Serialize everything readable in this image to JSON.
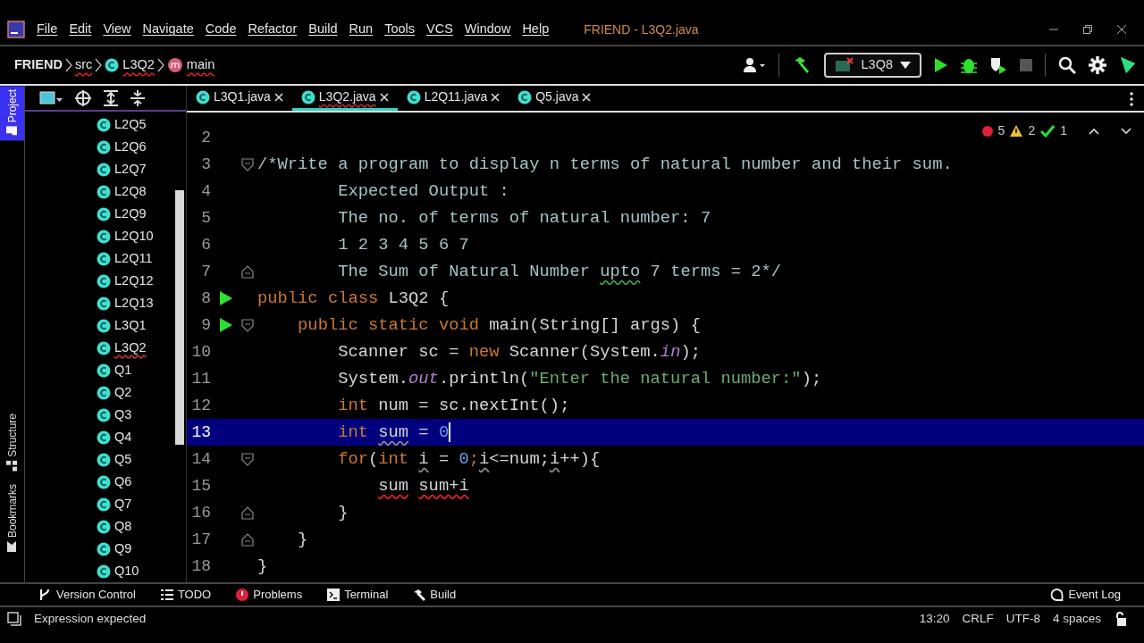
{
  "window": {
    "title": "FRIEND - L3Q2.java"
  },
  "menu": [
    "File",
    "Edit",
    "View",
    "Navigate",
    "Code",
    "Refactor",
    "Build",
    "Run",
    "Tools",
    "VCS",
    "Window",
    "Help"
  ],
  "breadcrumbs": [
    {
      "label": "FRIEND",
      "kind": "project"
    },
    {
      "label": "src",
      "kind": "folder"
    },
    {
      "label": "L3Q2",
      "kind": "class"
    },
    {
      "label": "main",
      "kind": "method"
    }
  ],
  "run_config": {
    "label": "L3Q8"
  },
  "side_tabs": [
    {
      "label": "Project",
      "selected": true
    },
    {
      "label": "Structure",
      "selected": false
    },
    {
      "label": "Bookmarks",
      "selected": false
    }
  ],
  "project_tree": [
    {
      "label": "L2Q5",
      "error": false
    },
    {
      "label": "L2Q6",
      "error": false
    },
    {
      "label": "L2Q7",
      "error": false
    },
    {
      "label": "L2Q8",
      "error": false
    },
    {
      "label": "L2Q9",
      "error": false
    },
    {
      "label": "L2Q10",
      "error": false
    },
    {
      "label": "L2Q11",
      "error": false
    },
    {
      "label": "L2Q12",
      "error": false
    },
    {
      "label": "L2Q13",
      "error": false
    },
    {
      "label": "L3Q1",
      "error": false
    },
    {
      "label": "L3Q2",
      "error": true
    },
    {
      "label": "Q1",
      "error": false
    },
    {
      "label": "Q2",
      "error": false
    },
    {
      "label": "Q3",
      "error": false
    },
    {
      "label": "Q4",
      "error": false
    },
    {
      "label": "Q5",
      "error": false
    },
    {
      "label": "Q6",
      "error": false
    },
    {
      "label": "Q7",
      "error": false
    },
    {
      "label": "Q8",
      "error": false
    },
    {
      "label": "Q9",
      "error": false
    },
    {
      "label": "Q10",
      "error": false
    }
  ],
  "tabs": [
    {
      "label": "L3Q1.java",
      "selected": false,
      "error": false
    },
    {
      "label": "L3Q2.java",
      "selected": true,
      "error": true
    },
    {
      "label": "L2Q11.java",
      "selected": false,
      "error": false
    },
    {
      "label": "Q5.java",
      "selected": false,
      "error": false
    }
  ],
  "inspections": {
    "errors": "5",
    "warnings": "2",
    "weak": "1"
  },
  "code_lines": [
    {
      "number": "2"
    },
    {
      "number": "3",
      "fold_start": true,
      "tokens": [
        {
          "text": "/*Write a program to display n terms of natural number and their sum.",
          "kind": "comment"
        }
      ]
    },
    {
      "number": "4",
      "tokens": [
        {
          "text": "        Expected Output :",
          "kind": "comment"
        }
      ]
    },
    {
      "number": "5",
      "tokens": [
        {
          "text": "        The no. of terms of natural number: 7",
          "kind": "comment"
        }
      ]
    },
    {
      "number": "6",
      "tokens": [
        {
          "text": "        1 2 3 4 5 6 7",
          "kind": "comment"
        }
      ]
    },
    {
      "number": "7",
      "fold_end": true,
      "tokens": [
        {
          "text": "        The Sum of Natural Number ",
          "kind": "comment"
        },
        {
          "text": "upto",
          "kind": "typo"
        },
        {
          "text": " 7 terms = 2*/",
          "kind": "comment"
        }
      ]
    },
    {
      "number": "8",
      "run": true,
      "tokens": [
        {
          "text": "public class ",
          "kind": "keyword"
        },
        {
          "text": "L3Q2 {",
          "kind": "plain"
        }
      ]
    },
    {
      "number": "9",
      "run": true,
      "fold_start": true,
      "tokens": [
        {
          "text": "    public static void ",
          "kind": "keyword"
        },
        {
          "text": "main(String[] args) {",
          "kind": "plain"
        }
      ]
    },
    {
      "number": "10",
      "tokens": [
        {
          "text": "        Scanner sc = ",
          "kind": "plain"
        },
        {
          "text": "new ",
          "kind": "keyword"
        },
        {
          "text": "Scanner(System.",
          "kind": "plain"
        },
        {
          "text": "in",
          "kind": "field"
        },
        {
          "text": ");",
          "kind": "plain"
        }
      ]
    },
    {
      "number": "11",
      "tokens": [
        {
          "text": "        System.",
          "kind": "plain"
        },
        {
          "text": "out",
          "kind": "field"
        },
        {
          "text": ".println(",
          "kind": "plain"
        },
        {
          "text": "\"Enter the natural number:\"",
          "kind": "string"
        },
        {
          "text": ");",
          "kind": "plain"
        }
      ]
    },
    {
      "number": "12",
      "tokens": [
        {
          "text": "        int ",
          "kind": "keyword"
        },
        {
          "text": "num = sc.nextInt();",
          "kind": "plain"
        }
      ]
    },
    {
      "number": "13",
      "current": true,
      "caret": true,
      "tokens": [
        {
          "text": "        int ",
          "kind": "keyword"
        },
        {
          "text": "sum",
          "kind": "warning"
        },
        {
          "text": " = ",
          "kind": "plain"
        },
        {
          "text": "0",
          "kind": "number"
        }
      ]
    },
    {
      "number": "14",
      "fold_start": true,
      "tokens": [
        {
          "text": "        for",
          "kind": "keyword"
        },
        {
          "text": "(",
          "kind": "plain"
        },
        {
          "text": "int ",
          "kind": "keyword"
        },
        {
          "text": "i",
          "kind": "warning"
        },
        {
          "text": " = ",
          "kind": "plain"
        },
        {
          "text": "0",
          "kind": "number"
        },
        {
          "text": ";",
          "kind": "keyword"
        },
        {
          "text": "i",
          "kind": "warning"
        },
        {
          "text": "<=num;",
          "kind": "plain"
        },
        {
          "text": "i",
          "kind": "warning"
        },
        {
          "text": "++){",
          "kind": "plain"
        }
      ]
    },
    {
      "number": "15",
      "tokens": [
        {
          "text": "            sum",
          "kind": "error"
        },
        {
          "text": " sum+i",
          "kind": "error"
        }
      ]
    },
    {
      "number": "16",
      "fold_end": true,
      "tokens": [
        {
          "text": "        }",
          "kind": "plain"
        }
      ]
    },
    {
      "number": "17",
      "fold_end": true,
      "tokens": [
        {
          "text": "    }",
          "kind": "plain"
        }
      ]
    },
    {
      "number": "18",
      "tokens": [
        {
          "text": "}",
          "kind": "plain"
        }
      ]
    }
  ],
  "tool_windows": [
    {
      "label": "Version Control",
      "kind": "vcs"
    },
    {
      "label": "TODO",
      "kind": "todo"
    },
    {
      "label": "Problems",
      "kind": "problems"
    },
    {
      "label": "Terminal",
      "kind": "terminal"
    },
    {
      "label": "Build",
      "kind": "build"
    }
  ],
  "event_log": "Event Log",
  "status_bar": {
    "message": "Expression expected",
    "position": "13:20",
    "line_separator": "CRLF",
    "encoding": "UTF-8",
    "indent": "4 spaces"
  }
}
